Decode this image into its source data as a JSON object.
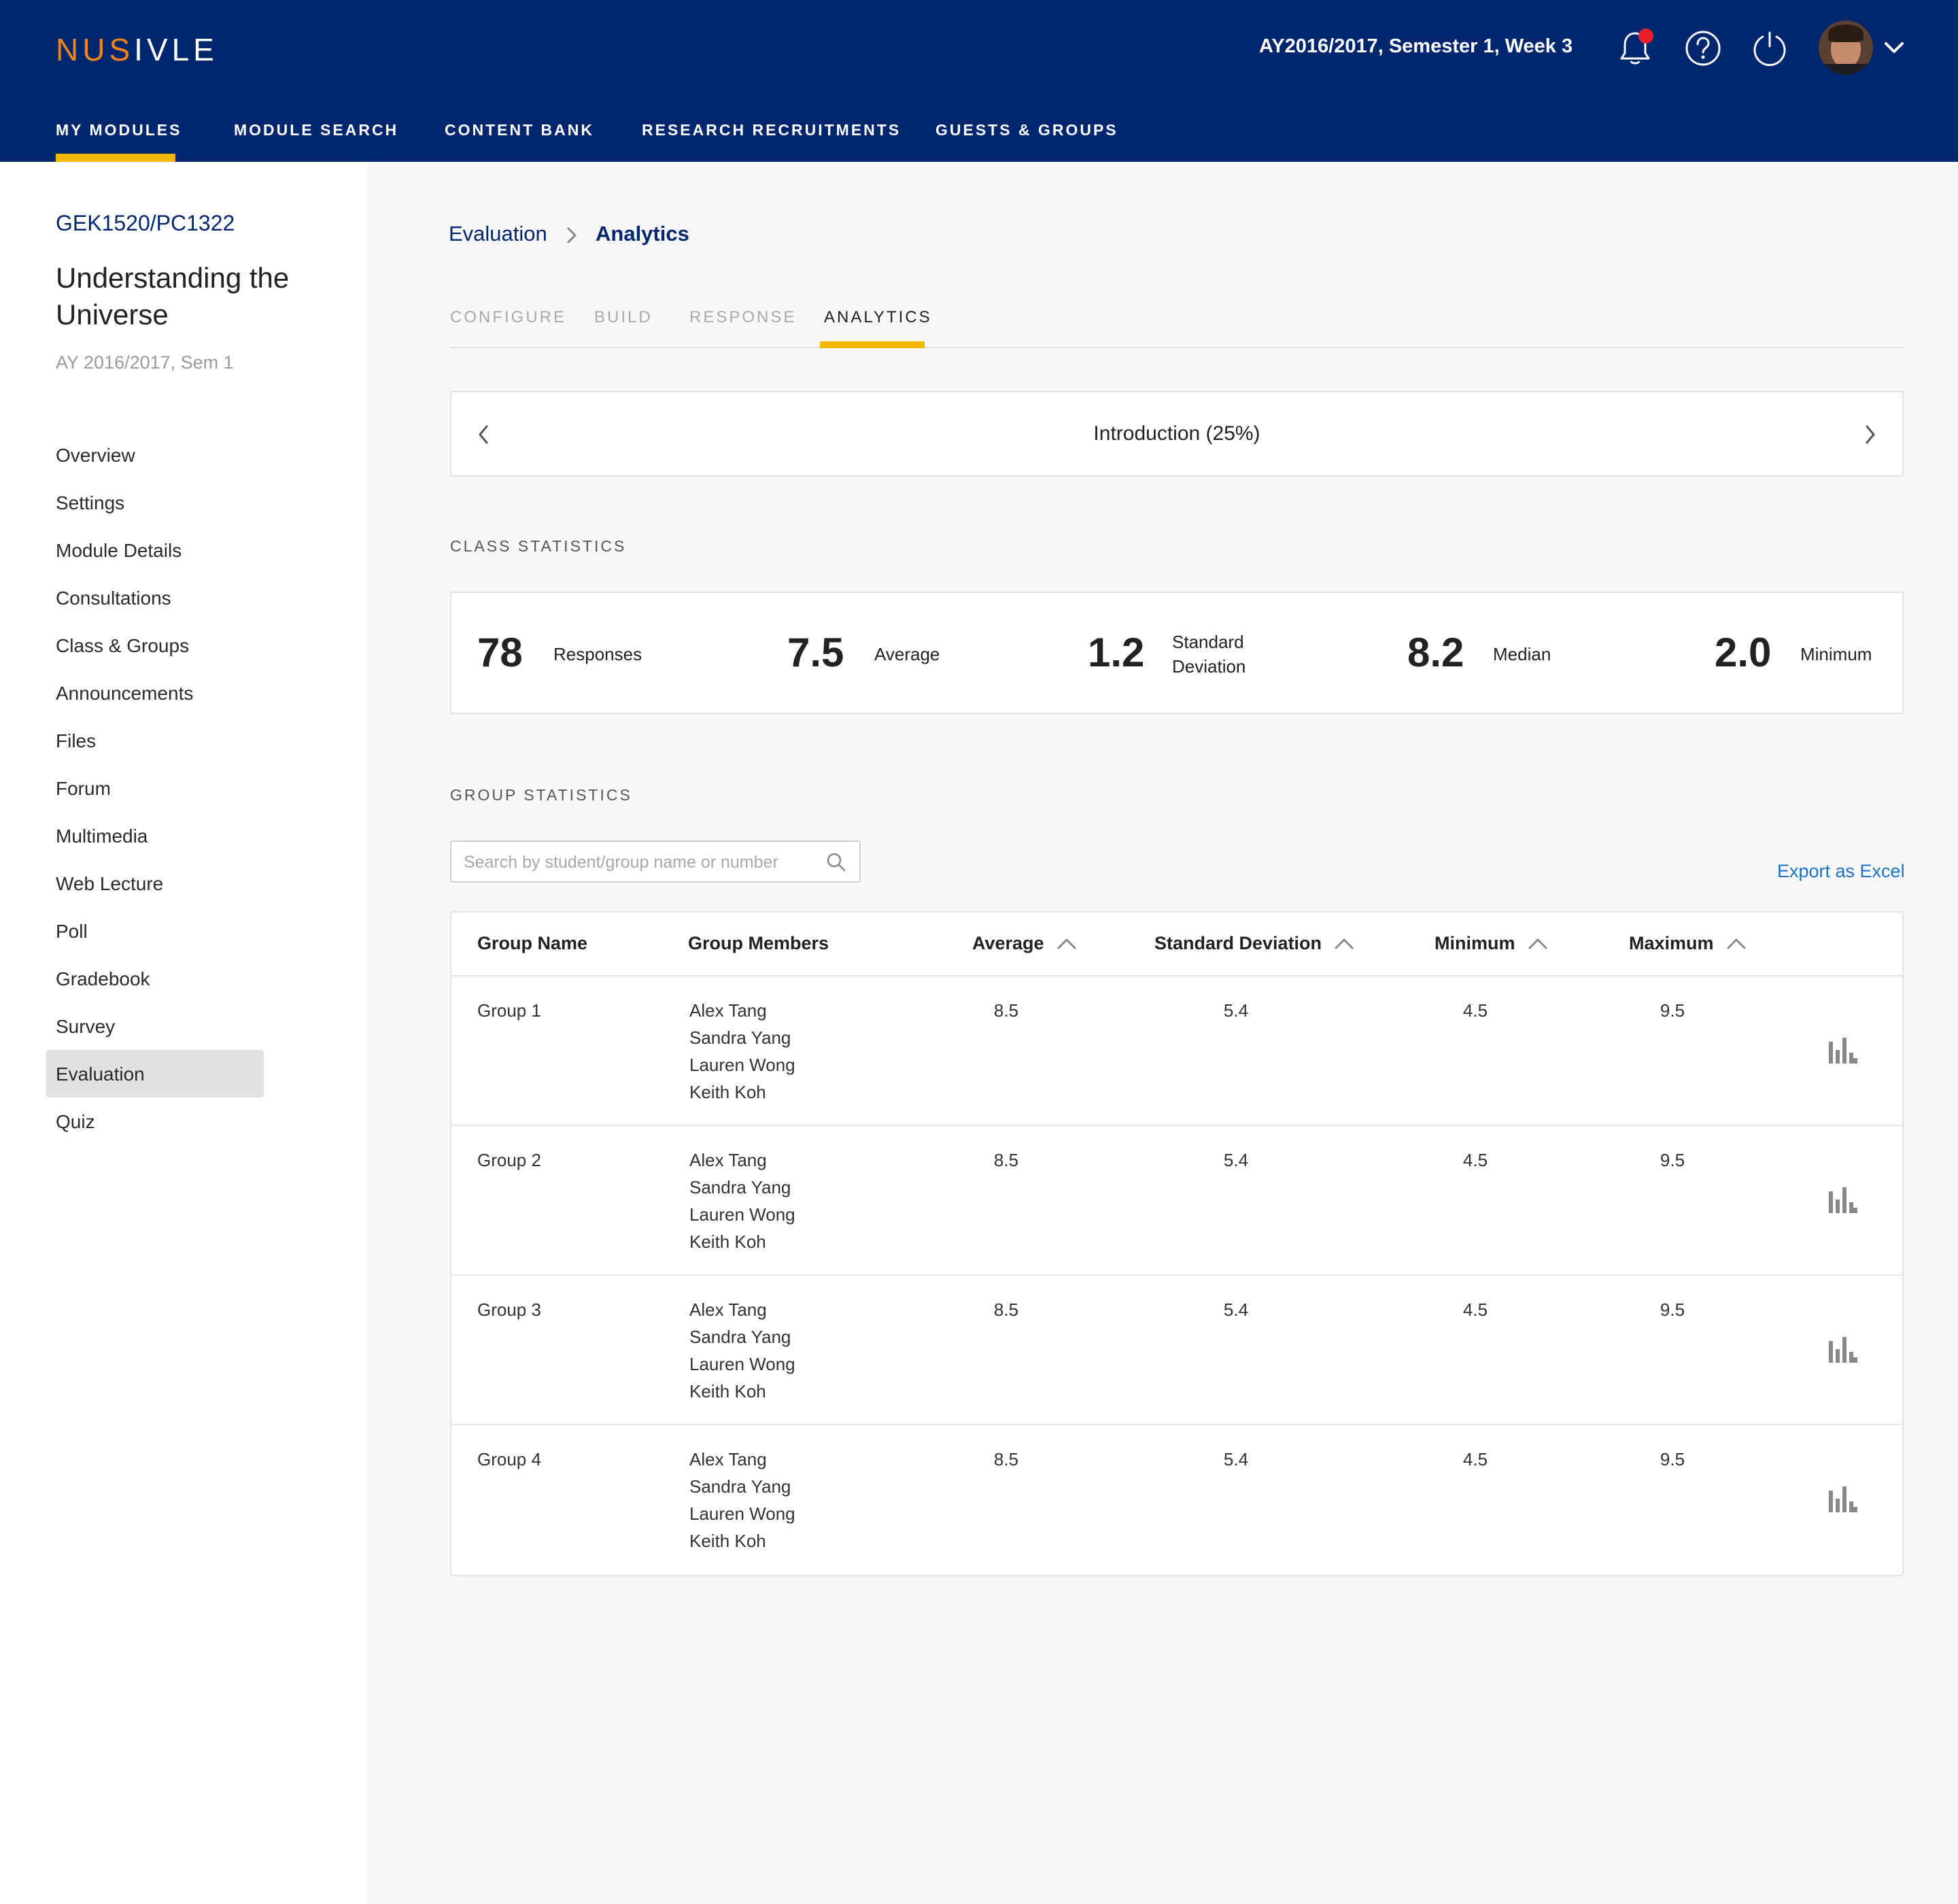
{
  "header": {
    "logo_nus": "NUS",
    "logo_ivle": "IVLE",
    "term": "AY2016/2017, Semester 1, Week 3",
    "nav": [
      "MY MODULES",
      "MODULE SEARCH",
      "CONTENT BANK",
      "RESEARCH RECRUITMENTS",
      "GUESTS & GROUPS"
    ],
    "active_nav": "MY MODULES",
    "icons": [
      "bell-icon",
      "help-icon",
      "power-icon",
      "avatar",
      "chevron-down-icon"
    ],
    "accent_color": "#f2b800",
    "brand_color": "#00266e",
    "notification_color": "#e8202a"
  },
  "sidebar": {
    "module_code": "GEK1520/PC1322",
    "module_title": "Understanding the Universe",
    "semester": "AY 2016/2017, Sem 1",
    "items": [
      "Overview",
      "Settings",
      "Module Details",
      "Consultations",
      "Class & Groups",
      "Announcements",
      "Files",
      "Forum",
      "Multimedia",
      "Web Lecture",
      "Poll",
      "Gradebook",
      "Survey",
      "Evaluation",
      "Quiz"
    ],
    "active_item": "Evaluation"
  },
  "breadcrumb": {
    "parent": "Evaluation",
    "current": "Analytics"
  },
  "tabs": {
    "items": [
      "CONFIGURE",
      "BUILD",
      "RESPONSE",
      "ANALYTICS"
    ],
    "active": "ANALYTICS"
  },
  "pager": {
    "title": "Introduction (25%)"
  },
  "class_statistics": {
    "label": "CLASS STATISTICS",
    "stats": [
      {
        "value": "78",
        "label": "Responses"
      },
      {
        "value": "7.5",
        "label": "Average"
      },
      {
        "value": "1.2",
        "label_line1": "Standard",
        "label_line2": "Deviation"
      },
      {
        "value": "8.2",
        "label": "Median"
      },
      {
        "value": "2.0",
        "label": "Minimum"
      }
    ]
  },
  "group_statistics": {
    "label": "GROUP STATISTICS",
    "search_placeholder": "Search by student/group name or number",
    "export_label": "Export as Excel",
    "columns": [
      "Group Name",
      "Group Members",
      "Average",
      "Standard Deviation",
      "Minimum",
      "Maximum"
    ],
    "rows": [
      {
        "name": "Group 1",
        "members": [
          "Alex Tang",
          "Sandra Yang",
          "Lauren Wong",
          "Keith Koh"
        ],
        "average": "8.5",
        "std": "5.4",
        "min": "4.5",
        "max": "9.5"
      },
      {
        "name": "Group 2",
        "members": [
          "Alex Tang",
          "Sandra Yang",
          "Lauren Wong",
          "Keith Koh"
        ],
        "average": "8.5",
        "std": "5.4",
        "min": "4.5",
        "max": "9.5"
      },
      {
        "name": "Group 3",
        "members": [
          "Alex Tang",
          "Sandra Yang",
          "Lauren Wong",
          "Keith Koh"
        ],
        "average": "8.5",
        "std": "5.4",
        "min": "4.5",
        "max": "9.5"
      },
      {
        "name": "Group 4",
        "members": [
          "Alex Tang",
          "Sandra Yang",
          "Lauren Wong",
          "Keith Koh"
        ],
        "average": "8.5",
        "std": "5.4",
        "min": "4.5",
        "max": "9.5"
      }
    ]
  }
}
